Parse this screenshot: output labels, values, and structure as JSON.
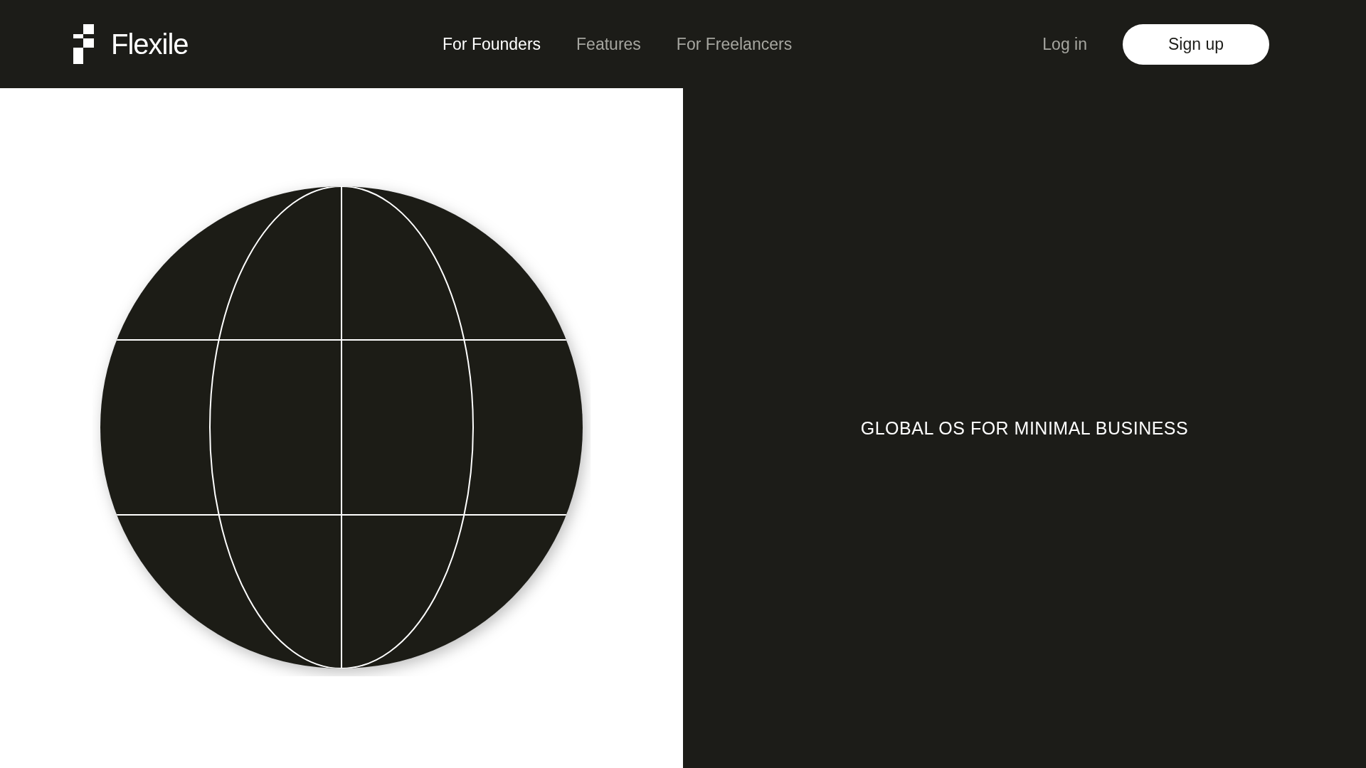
{
  "header": {
    "brand": "Flexile",
    "nav": [
      {
        "label": "For Founders",
        "selected": true
      },
      {
        "label": "Features",
        "selected": false
      },
      {
        "label": "For Freelancers",
        "selected": false
      }
    ],
    "login": "Log in",
    "signup": "Sign up"
  },
  "hero": {
    "tagline": "GLOBAL OS FOR MINIMAL BUSINESS"
  }
}
